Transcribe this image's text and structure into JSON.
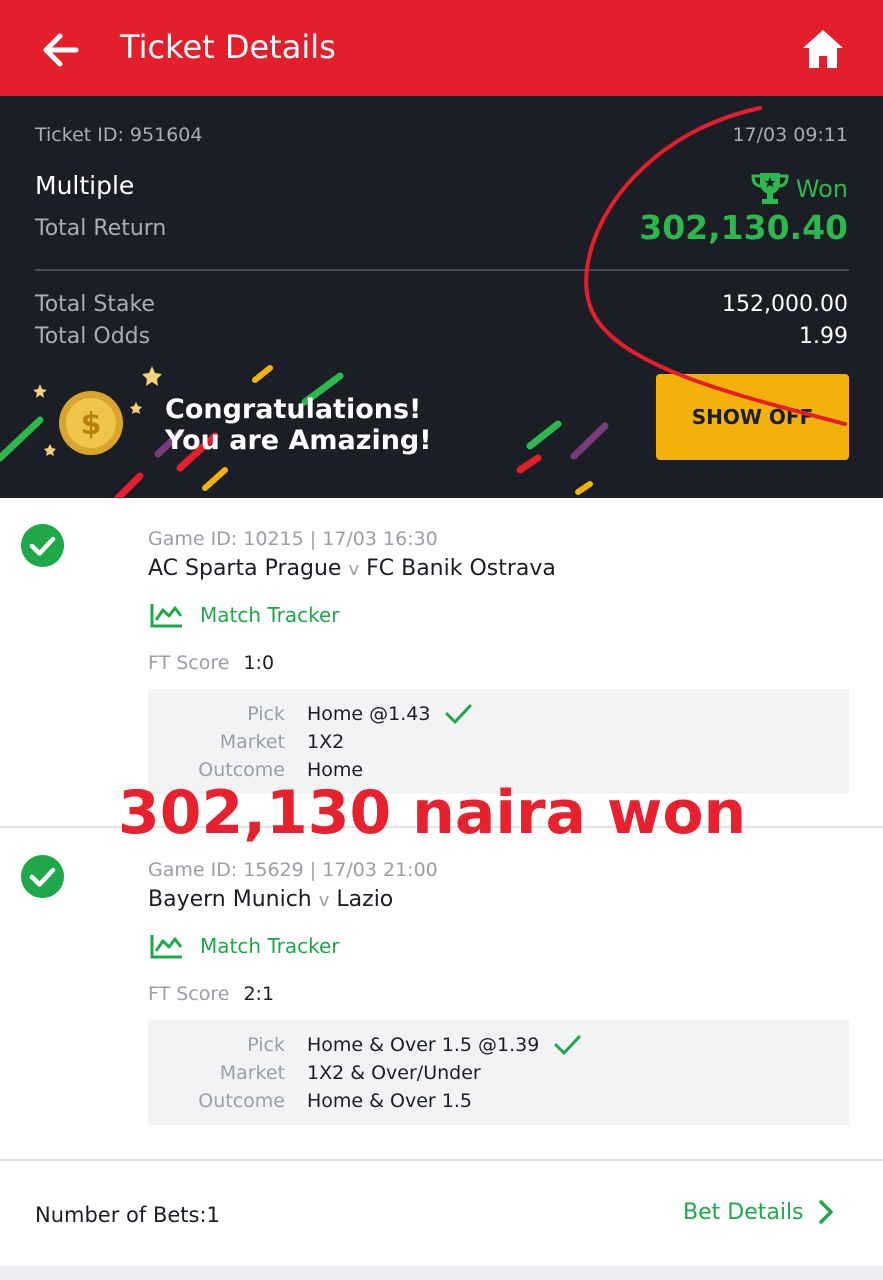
{
  "header": {
    "title": "Ticket Details",
    "back_icon": "arrow-left-icon",
    "home_icon": "home-icon"
  },
  "summary": {
    "ticket_id": "Ticket ID: 951604",
    "datetime": "17/03 09:11",
    "bet_type": "Multiple",
    "status": "Won",
    "total_return_label": "Total Return",
    "total_return": "302,130.40",
    "total_stake_label": "Total Stake",
    "total_stake": "152,000.00",
    "total_odds_label": "Total Odds",
    "total_odds": "1.99"
  },
  "banner": {
    "line1": "Congratulations!",
    "line2": "You are Amazing!",
    "show_off_label": "SHOW OFF"
  },
  "bets": [
    {
      "game_id": "Game ID: 10215 | 17/03 16:30",
      "home": "AC Sparta Prague",
      "vs": "v",
      "away": "FC Banik Ostrava",
      "tracker_label": "Match Tracker",
      "ft_label": "FT Score",
      "ft_score": "1:0",
      "pick_label": "Pick",
      "pick": "Home @1.43",
      "market_label": "Market",
      "market": "1X2",
      "outcome_label": "Outcome",
      "outcome": "Home"
    },
    {
      "game_id": "Game ID: 15629 | 17/03 21:00",
      "home": "Bayern Munich",
      "vs": "v",
      "away": "Lazio",
      "tracker_label": "Match Tracker",
      "ft_label": "FT Score",
      "ft_score": "2:1",
      "pick_label": "Pick",
      "pick": "Home & Over 1.5 @1.39",
      "market_label": "Market",
      "market": "1X2 & Over/Under",
      "outcome_label": "Outcome",
      "outcome": "Home & Over 1.5"
    }
  ],
  "overlay_text": "302,130 naira won",
  "footer": {
    "number_of_bets": "Number of Bets:1",
    "bet_details_label": "Bet Details"
  },
  "colors": {
    "brand_red": "#e41e2b",
    "win_green": "#2db84d",
    "accent_yellow": "#f2b20a",
    "dark_bg": "#1c1e26"
  }
}
